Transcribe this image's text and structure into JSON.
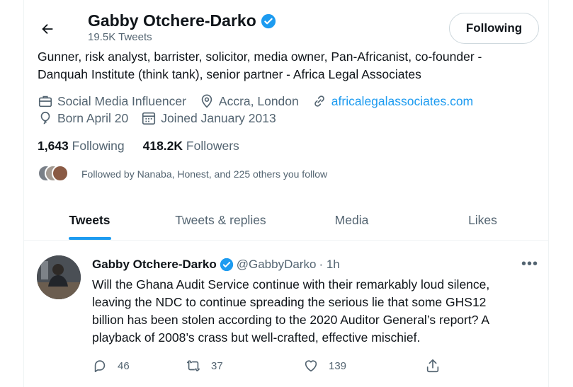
{
  "header": {
    "name": "Gabby Otchere-Darko",
    "tweet_count": "19.5K Tweets",
    "follow_button": "Following"
  },
  "profile": {
    "bio_line1": "Gunner, risk analyst, barrister, solicitor, media owner, Pan-Africanist, co-founder -",
    "bio_line2": "Danquah Institute (think tank), senior partner - Africa Legal Associates",
    "category": "Social Media Influencer",
    "location": "Accra, London",
    "website": "africalegalassociates.com",
    "birthday": "Born April 20",
    "joined": "Joined January 2013",
    "following_count": "1,643",
    "following_label": "Following",
    "followers_count": "418.2K",
    "followers_label": "Followers",
    "followed_by": "Followed by Nanaba, Honest, and 225 others you follow"
  },
  "tabs": [
    {
      "label": "Tweets"
    },
    {
      "label": "Tweets & replies"
    },
    {
      "label": "Media"
    },
    {
      "label": "Likes"
    }
  ],
  "tweet": {
    "name": "Gabby Otchere-Darko",
    "handle": "@GabbyDarko",
    "time": "· 1h",
    "line1": "Will the Ghana Audit Service continue with their remarkably loud silence,",
    "line2": "leaving the NDC to continue spreading the serious lie that some GHS12",
    "line3": "billion has been stolen according to the 2020 Auditor General’s report? A",
    "line4": "playback of 2008’s crass but well-crafted, effective mischief.",
    "replies": "46",
    "retweets": "37",
    "likes": "139"
  },
  "colors": {
    "accent": "#1d9bf0",
    "text": "#0f1419",
    "muted": "#536471",
    "border": "#eff3f4"
  },
  "icons": [
    "back-arrow-icon",
    "verified-badge-icon",
    "briefcase-icon",
    "location-pin-icon",
    "link-icon",
    "balloon-icon",
    "calendar-icon",
    "more-icon",
    "reply-icon",
    "retweet-icon",
    "like-icon",
    "share-icon"
  ]
}
